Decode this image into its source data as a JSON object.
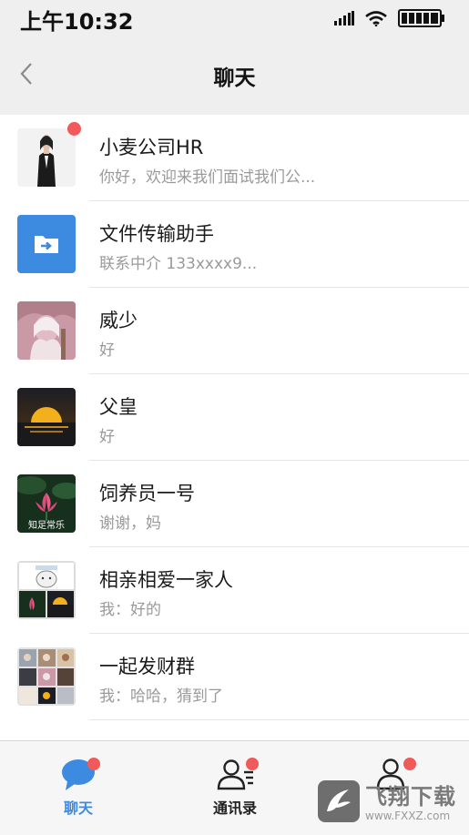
{
  "status_bar": {
    "time": "上午10:32",
    "icons": [
      "signal-icon",
      "wifi-icon",
      "battery-icon"
    ]
  },
  "nav": {
    "title": "聊天",
    "back_icon": "chevron-left-icon"
  },
  "chats": [
    {
      "name": "小麦公司HR",
      "preview": "你好，欢迎来我们面试我们公...",
      "avatar": "woman-portrait-avatar",
      "unread": true
    },
    {
      "name": "文件传输助手",
      "preview": "联系中介 133xxxx9...",
      "avatar": "file-transfer-avatar",
      "unread": false
    },
    {
      "name": "威少",
      "preview": "好",
      "avatar": "wizard-portrait-avatar",
      "unread": false
    },
    {
      "name": "父皇",
      "preview": "好",
      "avatar": "sunset-avatar",
      "unread": false
    },
    {
      "name": "饲养员一号",
      "preview": "谢谢，妈",
      "avatar": "lotus-avatar",
      "avatar_caption": "知足常乐",
      "unread": false
    },
    {
      "name": "相亲相爱一家人",
      "preview": "我：好的",
      "avatar": "group-collage-avatar",
      "unread": false
    },
    {
      "name": "一起发财群",
      "preview": "我：哈哈，猜到了",
      "avatar": "group-grid-avatar",
      "unread": false
    }
  ],
  "tabs": [
    {
      "label": "聊天",
      "icon": "chat-bubble-icon",
      "active": true,
      "badge": true
    },
    {
      "label": "通讯录",
      "icon": "contacts-icon",
      "active": false,
      "badge": true
    },
    {
      "label": "",
      "icon": "profile-icon",
      "active": false,
      "badge": true
    }
  ],
  "watermark": {
    "text": "飞翔下载",
    "url": "www.FXXZ.com"
  },
  "colors": {
    "accent_blue": "#3d8be0",
    "badge_red": "#f05a5a",
    "header_bg": "#efefef",
    "preview_gray": "#9a9a9a"
  }
}
